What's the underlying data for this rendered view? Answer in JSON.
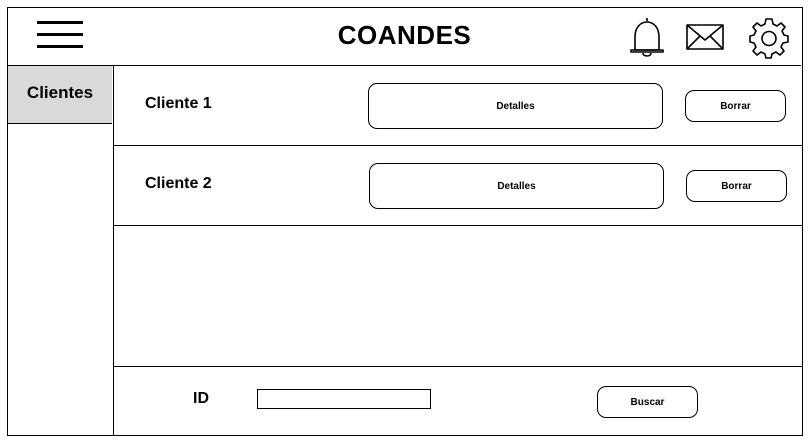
{
  "header": {
    "title": "COANDES",
    "icons": [
      "hamburger-menu-icon",
      "bell-icon",
      "mail-icon",
      "gear-icon"
    ]
  },
  "sidebar": {
    "items": [
      {
        "label": "Clientes",
        "active": true,
        "active_bg": "#d9d9d9"
      }
    ]
  },
  "clients": [
    {
      "name": "Cliente 1",
      "details_label": "Detalles",
      "delete_label": "Borrar"
    },
    {
      "name": "Cliente 2",
      "details_label": "Detalles",
      "delete_label": "Borrar"
    }
  ],
  "search": {
    "id_label": "ID",
    "input_value": "",
    "button_label": "Buscar"
  }
}
